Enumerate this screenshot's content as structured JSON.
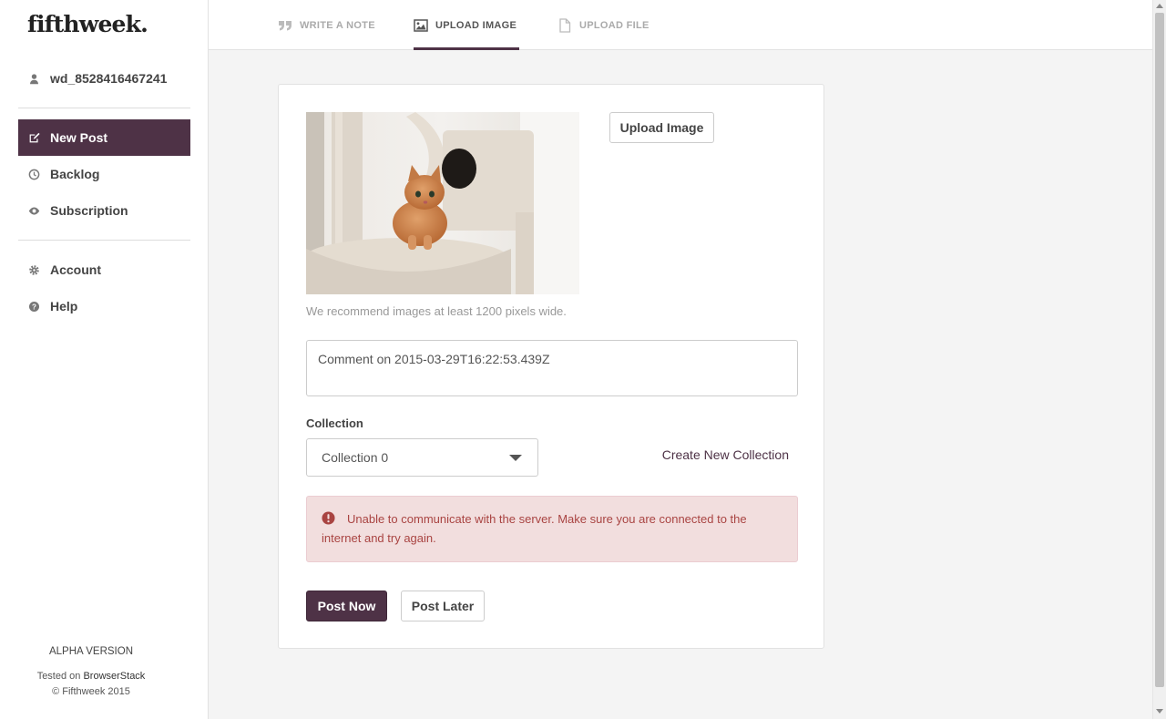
{
  "app": {
    "logo": "fifthweek."
  },
  "user": {
    "name": "wd_8528416467241"
  },
  "nav": {
    "items": [
      {
        "label": "New Post",
        "icon": "edit-icon",
        "active": true
      },
      {
        "label": "Backlog",
        "icon": "clock-icon",
        "active": false
      },
      {
        "label": "Subscription",
        "icon": "eye-icon",
        "active": false
      },
      {
        "label": "Account",
        "icon": "gear-icon",
        "active": false
      },
      {
        "label": "Help",
        "icon": "question-icon",
        "active": false
      }
    ]
  },
  "footer": {
    "version": "ALPHA VERSION",
    "tested_prefix": "Tested on",
    "tested_link": "BrowserStack",
    "copyright": "© Fifthweek 2015"
  },
  "tabs": [
    {
      "label": "WRITE A NOTE",
      "icon": "quote-icon",
      "active": false
    },
    {
      "label": "UPLOAD IMAGE",
      "icon": "image-icon",
      "active": true
    },
    {
      "label": "UPLOAD FILE",
      "icon": "file-icon",
      "active": false
    }
  ],
  "form": {
    "upload_button": "Upload Image",
    "hint": "We recommend images at least 1200 pixels wide.",
    "comment_value": "Comment on 2015-03-29T16:22:53.439Z",
    "collection_label": "Collection",
    "collection_selected": "Collection 0",
    "create_collection": "Create New Collection",
    "error_message": "Unable to communicate with the server. Make sure you are connected to the internet and try again.",
    "post_now": "Post Now",
    "post_later": "Post Later"
  },
  "colors": {
    "brand": "#4e3246",
    "error_bg": "#f2dede",
    "error_text": "#a94442"
  }
}
